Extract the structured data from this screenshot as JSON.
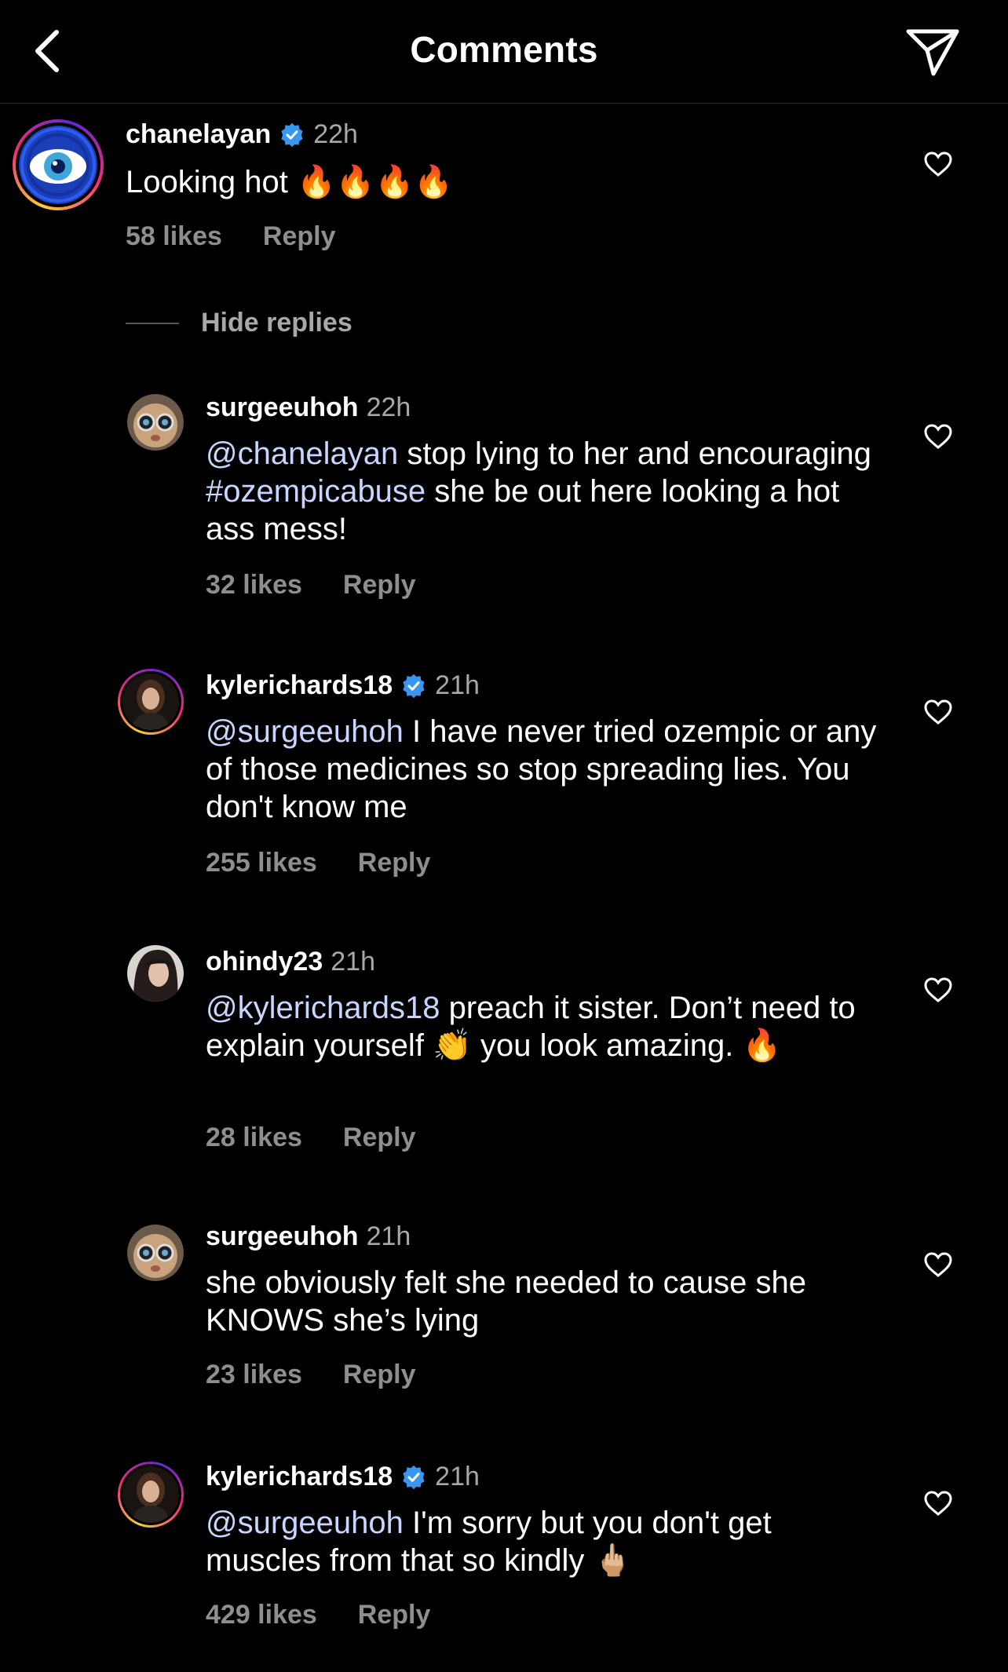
{
  "header": {
    "title": "Comments",
    "back_icon": "chevron-left-icon",
    "send_icon": "paper-plane-icon"
  },
  "colors": {
    "background": "#000000",
    "text": "#ffffff",
    "muted": "#8e8e8e",
    "mention": "#c7d6ff",
    "verified": "#3897f0"
  },
  "top_comment": {
    "username": "chanelayan",
    "verified": true,
    "time": "22h",
    "text": "Looking hot 🔥🔥🔥🔥",
    "likes": "58 likes",
    "reply_label": "Reply"
  },
  "hide_replies_label": "Hide replies",
  "replies": [
    {
      "username": "surgeeuhoh",
      "verified": false,
      "time": "22h",
      "mention": "@chanelayan",
      "text_a": " stop lying to her and encouraging ",
      "hashtag": "#ozempicabuse",
      "text_b": " she be out here looking a hot ass mess!",
      "likes": "32 likes",
      "reply_label": "Reply"
    },
    {
      "username": "kylerichards18",
      "verified": true,
      "time": "21h",
      "mention": "@surgeeuhoh",
      "text": " I have never tried ozempic or any of those medicines so stop spreading lies. You don't know me",
      "likes": "255 likes",
      "reply_label": "Reply"
    },
    {
      "username": "ohindy23",
      "verified": false,
      "time": "21h",
      "mention": "@kylerichards18",
      "text": " preach it sister. Don’t need to explain yourself 👏 you look amazing. 🔥",
      "likes": "28 likes",
      "reply_label": "Reply"
    },
    {
      "username": "surgeeuhoh",
      "verified": false,
      "time": "21h",
      "text": "she obviously felt she needed to cause she KNOWS she’s lying",
      "likes": "23 likes",
      "reply_label": "Reply"
    },
    {
      "username": "kylerichards18",
      "verified": true,
      "time": "21h",
      "mention": "@surgeeuhoh",
      "text": " I'm sorry but you don't get muscles from that so kindly 🖕🏼",
      "likes": "429 likes",
      "reply_label": "Reply"
    }
  ]
}
